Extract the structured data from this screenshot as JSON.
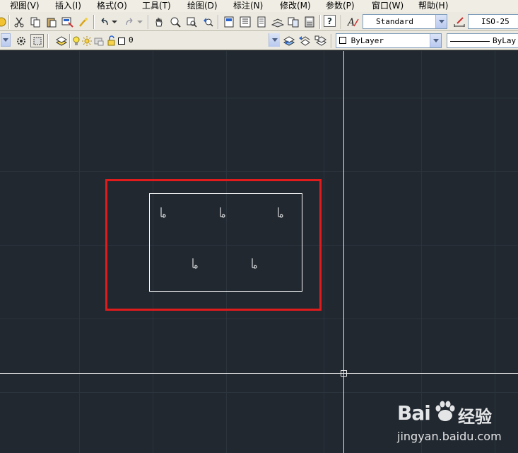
{
  "menu": {
    "items": [
      "视图(V)",
      "插入(I)",
      "格式(O)",
      "工具(T)",
      "绘图(D)",
      "标注(N)",
      "修改(M)",
      "参数(P)",
      "窗口(W)",
      "帮助(H)"
    ]
  },
  "toolbar_top": {
    "text_style_value": "Standard",
    "dim_style_value": "ISO-25",
    "icons": [
      "cut-icon",
      "copy-icon",
      "paste-icon",
      "match-properties-icon",
      "brush-icon",
      "undo-icon",
      "redo-icon",
      "pan-icon",
      "zoom-realtime-icon",
      "zoom-window-icon",
      "zoom-previous-icon",
      "properties-icon",
      "design-center-icon",
      "tool-palette-icon",
      "sheet-set-icon",
      "markup-icon",
      "calculator-icon",
      "help-icon",
      "text-style-icon",
      "dim-style-icon"
    ]
  },
  "toolbar_layers": {
    "layer_value": "0",
    "color_value": "ByLayer",
    "linetype_value": "ByLay",
    "icons": [
      "workspace-settings-icon",
      "layer-manager-icon",
      "lightbulb-icon",
      "sun-icon",
      "freeze-icon",
      "lock-icon",
      "layer-color-swatch-icon",
      "make-current-icon",
      "layer-previous-icon",
      "layer-state-icon"
    ]
  },
  "watermark": {
    "brand": "Bai",
    "brand_suffix": "经验",
    "url": "jingyan.baidu.com",
    "logo": "paw-logo-icon"
  },
  "colors": {
    "canvas": "#212830",
    "highlight": "#e01b1b",
    "crosshair": "#e8e8e8",
    "menu_bg": "#f0eee4"
  }
}
